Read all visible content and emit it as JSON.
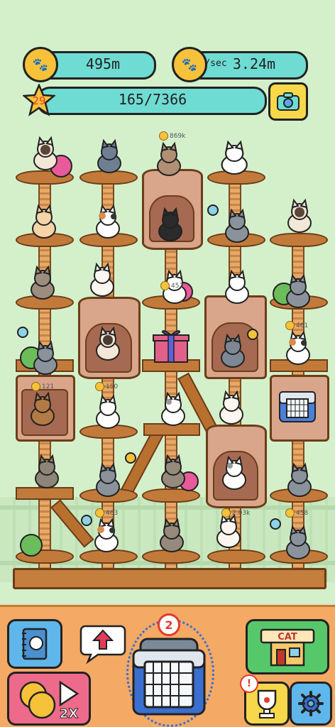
{
  "hud": {
    "coins_total": "495m",
    "coins_per_sec_prefix": "/sec",
    "coins_per_sec": "3.24m",
    "level": "29",
    "progress": "165/7366",
    "coin_icon": "paw-coin-icon",
    "camera_icon": "camera-icon"
  },
  "cat_coins": [
    {
      "label": "869k"
    },
    {
      "label": "452"
    },
    {
      "label": "461"
    },
    {
      "label": "121"
    },
    {
      "label": "150"
    },
    {
      "label": "463"
    },
    {
      "label": "2.03k"
    },
    {
      "label": "458"
    }
  ],
  "bottom": {
    "carrier_count": "2",
    "boost_label": "2X",
    "shop_sign": "CAT",
    "notice_mark": "!",
    "icons": {
      "album": "cat-album-icon",
      "upgrade": "up-arrow-icon",
      "carrier": "cat-carrier-icon",
      "shop": "cat-shop-icon",
      "boost": "coin-boost-video-icon",
      "trophy": "paw-trophy-icon",
      "settings": "gear-icon"
    }
  },
  "colors": {
    "background": "#d4f0cb",
    "hud_bar": "#6fdcd3",
    "coin": "#f6c23a",
    "wood": "#c27a3b",
    "panel": "#f4a964",
    "alert_red": "#e23b2f"
  }
}
